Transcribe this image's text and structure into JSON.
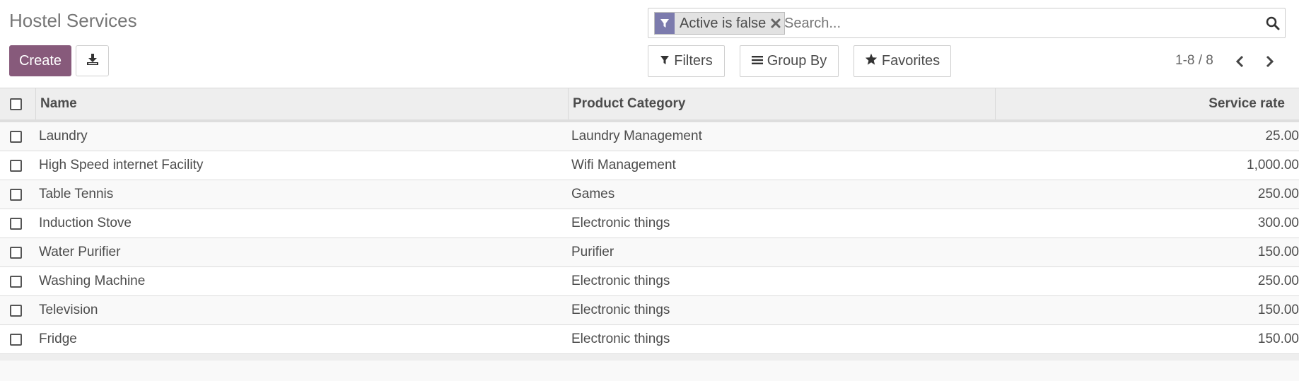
{
  "page": {
    "title": "Hostel Services"
  },
  "toolbar": {
    "create_label": "Create",
    "download_icon": "download-icon"
  },
  "search": {
    "facet_label": "Active is false",
    "facet_icon": "filter-icon",
    "placeholder": "Search...",
    "value": ""
  },
  "controls": {
    "filters_label": "Filters",
    "group_by_label": "Group By",
    "favorites_label": "Favorites"
  },
  "pager": {
    "value": "1-8 / 8"
  },
  "table": {
    "columns": [
      "Name",
      "Product Category",
      "Service rate"
    ],
    "rows": [
      {
        "name": "Laundry",
        "category": "Laundry Management",
        "rate": "25.00"
      },
      {
        "name": "High Speed internet Facility",
        "category": "Wifi Management",
        "rate": "1,000.00"
      },
      {
        "name": "Table Tennis",
        "category": "Games",
        "rate": "250.00"
      },
      {
        "name": "Induction Stove",
        "category": "Electronic things",
        "rate": "300.00"
      },
      {
        "name": "Water Purifier",
        "category": "Purifier",
        "rate": "150.00"
      },
      {
        "name": "Washing Machine",
        "category": "Electronic things",
        "rate": "250.00"
      },
      {
        "name": "Television",
        "category": "Electronic things",
        "rate": "150.00"
      },
      {
        "name": "Fridge",
        "category": "Electronic things",
        "rate": "150.00"
      }
    ]
  },
  "colors": {
    "primary": "#875A7B",
    "facet": "#7C7BAD",
    "header_bg": "#EEEEEE"
  }
}
